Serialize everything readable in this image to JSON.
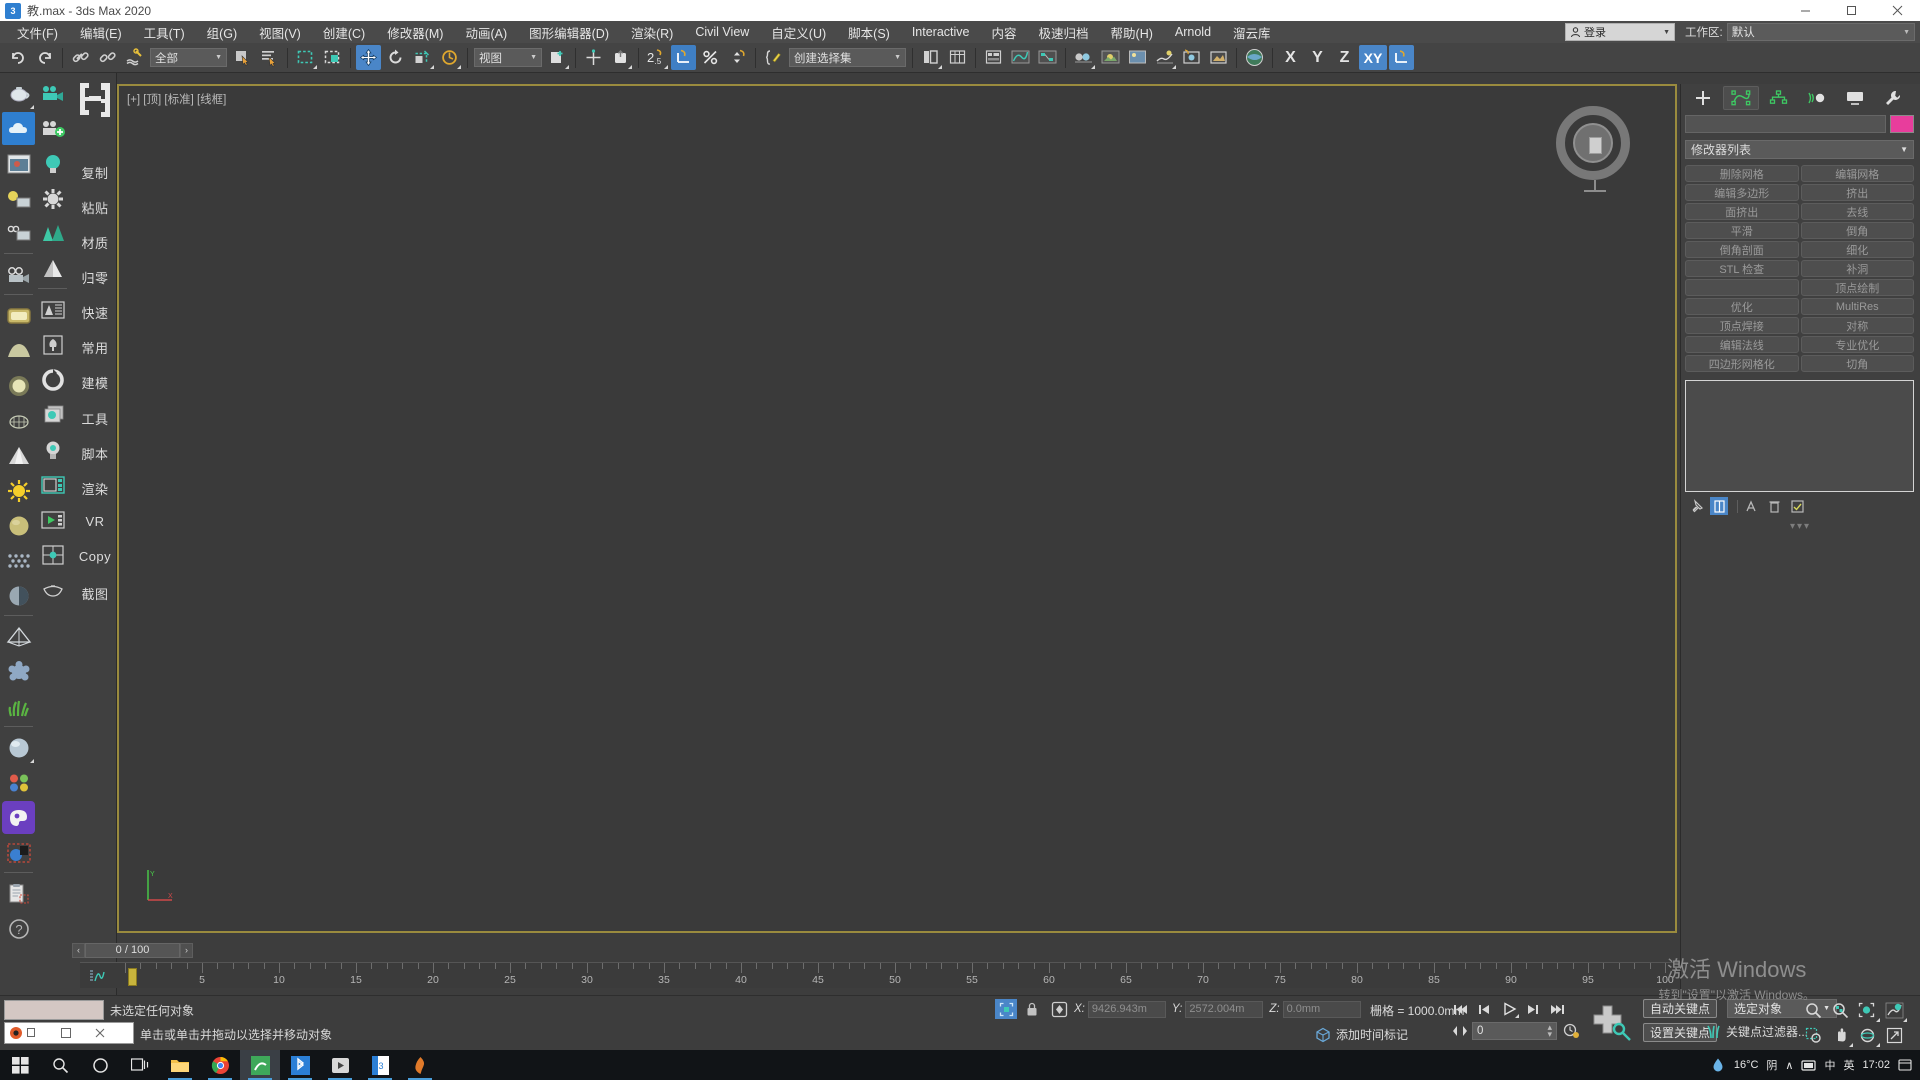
{
  "window": {
    "title": "教.max - 3ds Max 2020",
    "minimize": "—",
    "maximize": "▢",
    "close": "✕"
  },
  "menu": {
    "items": [
      {
        "label": "文件(F)"
      },
      {
        "label": "编辑(E)"
      },
      {
        "label": "工具(T)"
      },
      {
        "label": "组(G)"
      },
      {
        "label": "视图(V)"
      },
      {
        "label": "创建(C)"
      },
      {
        "label": "修改器(M)"
      },
      {
        "label": "动画(A)"
      },
      {
        "label": "图形编辑器(D)"
      },
      {
        "label": "渲染(R)"
      },
      {
        "label": "Civil View"
      },
      {
        "label": "自定义(U)"
      },
      {
        "label": "脚本(S)"
      },
      {
        "label": "Interactive"
      },
      {
        "label": "内容"
      },
      {
        "label": "极速归档"
      },
      {
        "label": "帮助(H)"
      },
      {
        "label": "Arnold"
      },
      {
        "label": "溜云库"
      }
    ]
  },
  "account": {
    "login_label": "登录",
    "person_icon": "person-icon",
    "arrow": "▼"
  },
  "workspace": {
    "label": "工作区:",
    "value": "默认",
    "arrow": "▼"
  },
  "main_toolbar": {
    "selection_filter": "全部",
    "selection_filter_arrow": "▼",
    "reference_coordinate": "视图",
    "reference_coordinate_arrow": "▼",
    "named_selection_set": "创建选择集",
    "named_selection_set_arrow": "▼",
    "axis_x": "X",
    "axis_y": "Y",
    "axis_z": "Z",
    "axis_xy": "XY",
    "buttons": [
      {
        "name": "undo-icon"
      },
      {
        "name": "redo-icon"
      },
      {
        "name": "select-and-link-icon"
      },
      {
        "name": "unlink-selection-icon"
      },
      {
        "name": "bind-to-space-warp-icon"
      },
      {
        "name": "select-object-icon"
      },
      {
        "name": "select-by-name-icon"
      },
      {
        "name": "rectangular-selection-region-icon"
      },
      {
        "name": "window-crossing-icon"
      },
      {
        "name": "select-and-move-icon"
      },
      {
        "name": "select-and-rotate-icon"
      },
      {
        "name": "select-and-scale-icon"
      },
      {
        "name": "select-and-place-icon"
      },
      {
        "name": "use-center-icon"
      },
      {
        "name": "mirror-icon"
      },
      {
        "name": "align-icon"
      },
      {
        "name": "snaps-toggle-25-icon"
      },
      {
        "name": "angle-snap-icon"
      },
      {
        "name": "percent-snap-icon"
      },
      {
        "name": "spinner-snap-icon"
      },
      {
        "name": "edit-named-selection-icon"
      },
      {
        "name": "layer-explorer-icon"
      },
      {
        "name": "layer-manager-icon"
      },
      {
        "name": "curve-editor-icon"
      },
      {
        "name": "schematic-view-icon"
      },
      {
        "name": "material-editor-icon"
      },
      {
        "name": "render-setup-icon"
      },
      {
        "name": "render-frame-window-icon"
      },
      {
        "name": "render-production-icon"
      },
      {
        "name": "render-iterative-icon"
      },
      {
        "name": "active-shade-icon"
      },
      {
        "name": "project-folder-icon"
      }
    ]
  },
  "left_toolbar": {
    "labels": [
      {
        "label": "复制",
        "name": "sidebar-label-copy"
      },
      {
        "label": "粘贴",
        "name": "sidebar-label-paste"
      },
      {
        "label": "材质",
        "name": "sidebar-label-material"
      },
      {
        "label": "归零",
        "name": "sidebar-label-zero"
      },
      {
        "label": "快速",
        "name": "sidebar-label-quick"
      },
      {
        "label": "常用",
        "name": "sidebar-label-common"
      },
      {
        "label": "建模",
        "name": "sidebar-label-modeling"
      },
      {
        "label": "工具",
        "name": "sidebar-label-tools"
      },
      {
        "label": "脚本",
        "name": "sidebar-label-script"
      },
      {
        "label": "渲染",
        "name": "sidebar-label-render"
      },
      {
        "label": "VR",
        "name": "sidebar-label-vr"
      },
      {
        "label": "Copy",
        "name": "sidebar-label-copy-en"
      },
      {
        "label": "截图",
        "name": "sidebar-label-screenshot"
      }
    ],
    "column1_icons": [
      "teapot-icon",
      "cloud-icon",
      "picture-frame-icon",
      "light-bulb-panel-icon",
      "camera-panel-icon",
      "movie-camera-icon",
      "plate-icon",
      "dome-icon",
      "sphere-light-icon",
      "wireframe-teapot-icon",
      "cone-light-icon",
      "sun-icon",
      "gold-sphere-icon",
      "mesh-grid-icon",
      "half-sphere-icon",
      "pyramid-wire-icon",
      "blue-cluster-icon",
      "grass-icon",
      "glass-sphere-icon",
      "color-balls-icon",
      "purple-palette-icon",
      "select-sphere-icon",
      "clipboard-icon",
      "help-icon"
    ],
    "column2_icons": [
      "video-camera-icon",
      "add-camera-icon",
      "bulb-icon",
      "light-star-icon",
      "trees-icon",
      "tree-icon",
      "tree-panel-icon",
      "tree-doc-icon",
      "ring-icon",
      "layers-icon",
      "bulb-gear-icon",
      "window-panel-icon",
      "play-panel-icon",
      "grid-node-icon",
      "teapot-outline-icon"
    ]
  },
  "viewport": {
    "label": "[+] [顶] [标准] [线框]",
    "viewcube_name": "viewcube",
    "axis_tripod": "axis-tripod"
  },
  "command_panel": {
    "tabs": [
      {
        "name": "create-tab",
        "glyph": "+"
      },
      {
        "name": "modify-tab",
        "glyph": "modify"
      },
      {
        "name": "hierarchy-tab",
        "glyph": "hierarchy"
      },
      {
        "name": "motion-tab",
        "glyph": "motion"
      },
      {
        "name": "display-tab",
        "glyph": "display"
      },
      {
        "name": "utilities-tab",
        "glyph": "wrench"
      }
    ],
    "object_name": "",
    "object_color": "#e83d9c",
    "modifier_list": "修改器列表",
    "modifier_list_arrow": "▼",
    "buttons": [
      [
        "删除网格",
        "编辑网格"
      ],
      [
        "编辑多边形",
        "挤出"
      ],
      [
        "面挤出",
        "去线"
      ],
      [
        "平滑",
        "倒角"
      ],
      [
        "倒角剖面",
        "细化"
      ],
      [
        "STL 检查",
        "补洞"
      ],
      [
        "",
        "顶点绘制"
      ],
      [
        "优化",
        "MultiRes"
      ],
      [
        "顶点焊接",
        "对称"
      ],
      [
        "编辑法线",
        "专业优化"
      ],
      [
        "四边形网格化",
        "切角"
      ]
    ],
    "stack_icons": [
      "pin-stack-icon",
      "show-end-result-icon",
      "make-unique-icon",
      "remove-modifier-icon",
      "configure-sets-icon"
    ],
    "dots": "▾▾▾"
  },
  "timeline": {
    "prev_arrow": "‹",
    "frame_display": "0 / 100",
    "next_arrow": "›",
    "ticks": [
      {
        "label": "5",
        "value": 5
      },
      {
        "label": "10",
        "value": 10
      },
      {
        "label": "15",
        "value": 15
      },
      {
        "label": "20",
        "value": 20
      },
      {
        "label": "25",
        "value": 25
      },
      {
        "label": "30",
        "value": 30
      },
      {
        "label": "35",
        "value": 35
      },
      {
        "label": "40",
        "value": 40
      },
      {
        "label": "45",
        "value": 45
      },
      {
        "label": "50",
        "value": 50
      },
      {
        "label": "55",
        "value": 55
      },
      {
        "label": "60",
        "value": 60
      },
      {
        "label": "65",
        "value": 65
      },
      {
        "label": "70",
        "value": 70
      },
      {
        "label": "75",
        "value": 75
      },
      {
        "label": "80",
        "value": 80
      },
      {
        "label": "85",
        "value": 85
      },
      {
        "label": "90",
        "value": 90
      },
      {
        "label": "95",
        "value": 95
      },
      {
        "label": "100",
        "value": 100
      }
    ],
    "range_min": 0,
    "range_max": 100,
    "current_frame": 0
  },
  "status_bar": {
    "selection_status": "未选定任何对象",
    "prompt": "单击或单击并拖动以选择并移动对象",
    "coord_x_label": "X:",
    "coord_x_value": "9426.943m",
    "coord_y_label": "Y:",
    "coord_y_value": "2572.004m",
    "coord_z_label": "Z:",
    "coord_z_value": "0.0mm",
    "grid_label": "栅格 = 1000.0mm",
    "add_time_tag": "添加时间标记",
    "auto_key": "自动关键点",
    "set_key": "设置关键点",
    "key_filter": "关键点过滤器...",
    "selection_mode": "选定对象",
    "selection_mode_arrow": "▼",
    "current_frame_field": "0",
    "nav_icons": [
      "zoom-icon",
      "zoom-all-icon",
      "zoom-extents-icon",
      "zoom-region-icon",
      "field-of-view-icon",
      "pan-icon",
      "orbit-icon",
      "maximize-viewport-icon"
    ],
    "playback_icons": [
      "go-to-start-icon",
      "previous-frame-icon",
      "play-icon",
      "next-frame-icon",
      "go-to-end-icon"
    ],
    "key_mode_icon": "key-mode-icon",
    "time-config-icon": "time-configuration-icon",
    "lock_icon": "selection-lock-icon",
    "abs_rel_icon": "absolute-relative-icon",
    "iso_icon": "isolate-selection-icon"
  },
  "watermark": {
    "line1": "激活 Windows",
    "line2": "转到\"设置\"以激活 Windows。"
  },
  "taskbar": {
    "icons": [
      {
        "name": "start-icon"
      },
      {
        "name": "search-icon"
      },
      {
        "name": "cortana-icon"
      },
      {
        "name": "task-view-icon"
      },
      {
        "name": "file-explorer-icon"
      },
      {
        "name": "chrome-icon"
      },
      {
        "name": "3dsmax-icon"
      },
      {
        "name": "bluetooth-app-icon"
      },
      {
        "name": "media-icon"
      },
      {
        "name": "word-icon"
      },
      {
        "name": "flame-icon"
      }
    ],
    "tray": {
      "weather_temp": "16°C",
      "weather_desc": "阴",
      "chevron": "∧",
      "network_icon": "network-icon",
      "ime": "中",
      "ime2": "英",
      "time": "17:02",
      "notification_icon": "notification-icon"
    }
  },
  "colors": {
    "accent_blue": "#4a86c8",
    "viewport_border": "#9a8b3e",
    "panel_bg": "#404040",
    "toolbar_bg": "#444444",
    "object_color": "#e83d9c",
    "slider_yellow": "#c8b43c"
  }
}
